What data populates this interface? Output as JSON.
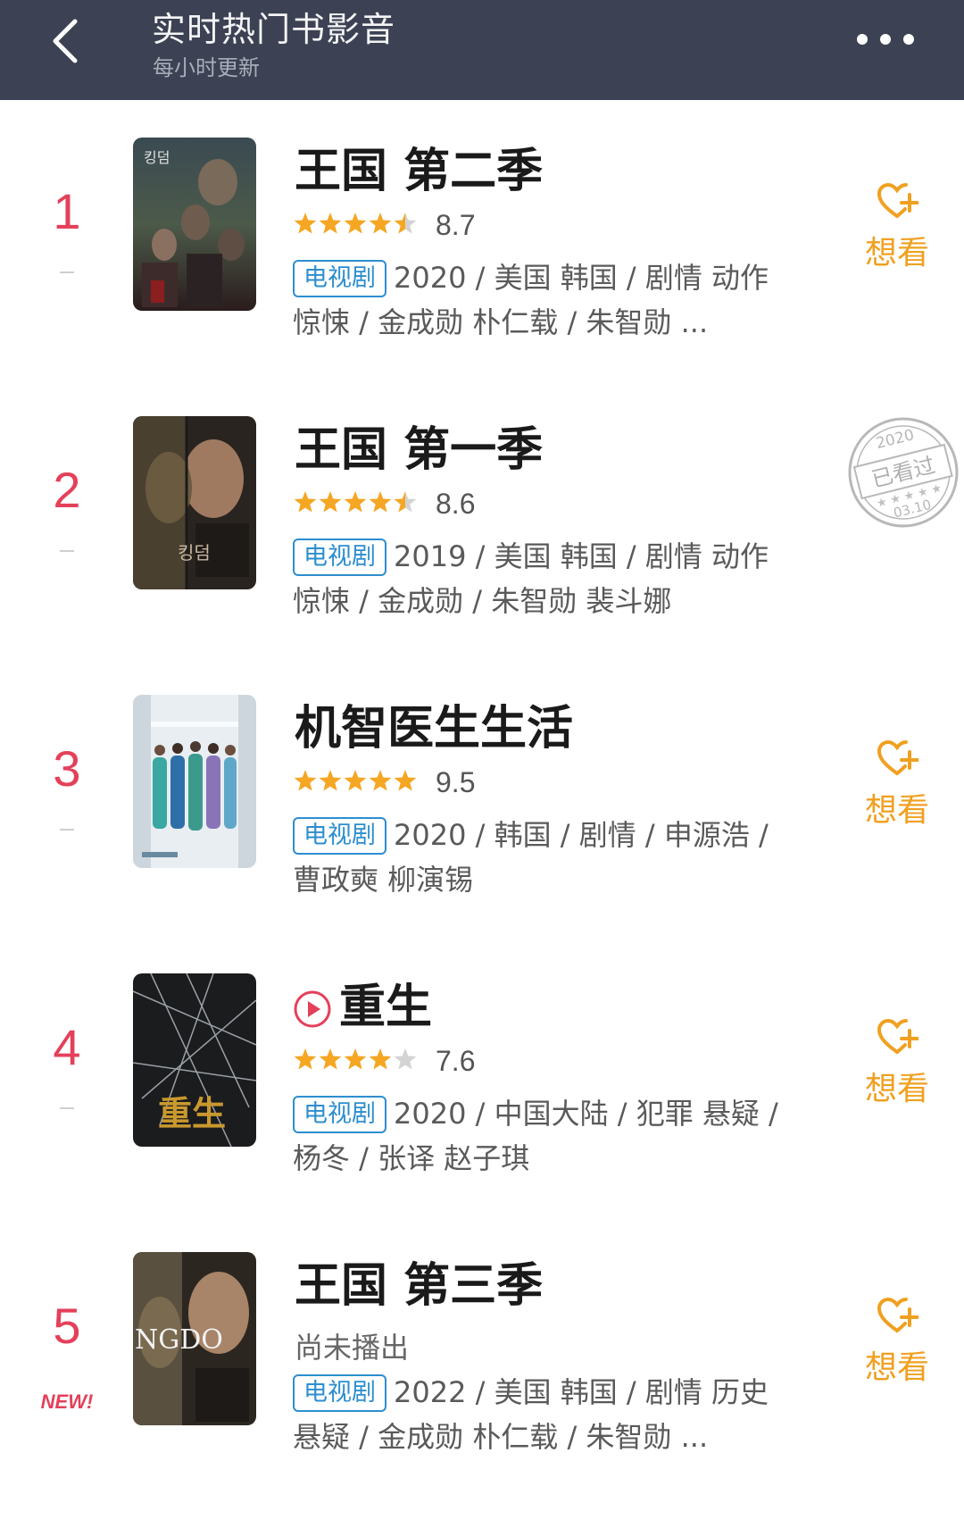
{
  "header": {
    "title": "实时热门书影音",
    "subtitle": "每小时更新"
  },
  "items": [
    {
      "rank": "1",
      "name": "王国 第二季",
      "rating": 4.5,
      "score": "8.7",
      "tag": "电视剧",
      "meta": "2020 / 美国 韩国 / 剧情 动作 惊悚 / 金成勋 朴仁载 / 朱智勋 ...",
      "action": "想看"
    },
    {
      "rank": "2",
      "name": "王国 第一季",
      "rating": 4.5,
      "score": "8.6",
      "tag": "电视剧",
      "meta": "2019 / 美国 韩国 / 剧情 动作 惊悚 / 金成勋 / 朱智勋 裴斗娜",
      "stamp": {
        "year": "2020",
        "label": "已看过",
        "date": "03.10"
      }
    },
    {
      "rank": "3",
      "name": "机智医生生活",
      "rating": 5,
      "score": "9.5",
      "tag": "电视剧",
      "meta": "2020 / 韩国 / 剧情 / 申源浩 / 曹政奭 柳演锡",
      "action": "想看"
    },
    {
      "rank": "4",
      "name": "重生",
      "rating": 4,
      "score": "7.6",
      "tag": "电视剧",
      "meta": "2020 / 中国大陆 / 犯罪 悬疑 / 杨冬 / 张译 赵子琪",
      "action": "想看",
      "poster_text": "重生"
    },
    {
      "rank": "5",
      "badge": "NEW!",
      "name": "王国 第三季",
      "status": "尚未播出",
      "tag": "电视剧",
      "meta": "2022 / 美国 韩国 / 剧情 历史 悬疑 / 金成勋 朴仁载 / 朱智勋 ...",
      "action": "想看",
      "poster_text": "NGDO"
    }
  ],
  "colors": {
    "header_bg": "#3c4253",
    "rank": "#e4405a",
    "star": "#f5a623",
    "tag": "#2d8ecf",
    "want": "#f0a020"
  }
}
